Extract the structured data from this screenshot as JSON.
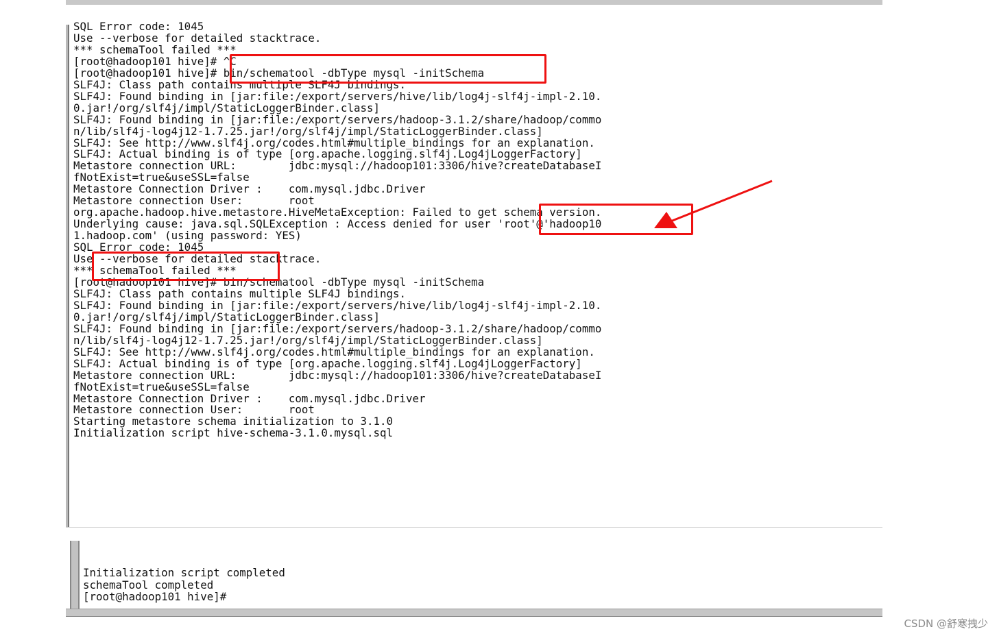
{
  "terminal_main": {
    "lines": "SQL Error code: 1045\nUse --verbose for detailed stacktrace.\n*** schemaTool failed ***\n[root@hadoop101 hive]# ^C\n[root@hadoop101 hive]# bin/schematool -dbType mysql -initSchema\nSLF4J: Class path contains multiple SLF4J bindings.\nSLF4J: Found binding in [jar:file:/export/servers/hive/lib/log4j-slf4j-impl-2.10.\n0.jar!/org/slf4j/impl/StaticLoggerBinder.class]\nSLF4J: Found binding in [jar:file:/export/servers/hadoop-3.1.2/share/hadoop/commo\nn/lib/slf4j-log4j12-1.7.25.jar!/org/slf4j/impl/StaticLoggerBinder.class]\nSLF4J: See http://www.slf4j.org/codes.html#multiple_bindings for an explanation.\nSLF4J: Actual binding is of type [org.apache.logging.slf4j.Log4jLoggerFactory]\nMetastore connection URL:        jdbc:mysql://hadoop101:3306/hive?createDatabaseI\nfNotExist=true&useSSL=false\nMetastore Connection Driver :    com.mysql.jdbc.Driver\nMetastore connection User:       root\norg.apache.hadoop.hive.metastore.HiveMetaException: Failed to get schema version.\nUnderlying cause: java.sql.SQLException : Access denied for user 'root'@'hadoop10\n1.hadoop.com' (using password: YES)\nSQL Error code: 1045\nUse --verbose for detailed stacktrace.\n*** schemaTool failed ***\n[root@hadoop101 hive]# bin/schematool -dbType mysql -initSchema\nSLF4J: Class path contains multiple SLF4J bindings.\nSLF4J: Found binding in [jar:file:/export/servers/hive/lib/log4j-slf4j-impl-2.10.\n0.jar!/org/slf4j/impl/StaticLoggerBinder.class]\nSLF4J: Found binding in [jar:file:/export/servers/hadoop-3.1.2/share/hadoop/commo\nn/lib/slf4j-log4j12-1.7.25.jar!/org/slf4j/impl/StaticLoggerBinder.class]\nSLF4J: See http://www.slf4j.org/codes.html#multiple_bindings for an explanation.\nSLF4J: Actual binding is of type [org.apache.logging.slf4j.Log4jLoggerFactory]\nMetastore connection URL:        jdbc:mysql://hadoop101:3306/hive?createDatabaseI\nfNotExist=true&useSSL=false\nMetastore Connection Driver :    com.mysql.jdbc.Driver\nMetastore connection User:       root\nStarting metastore schema initialization to 3.1.0\nInitialization script hive-schema-3.1.0.mysql.sql"
  },
  "terminal_tail": {
    "lines": "Initialization script completed\nschemaTool completed\n[root@hadoop101 hive]#"
  },
  "annotation_color": "#ee1111",
  "watermark": "CSDN @舒寒拽少"
}
